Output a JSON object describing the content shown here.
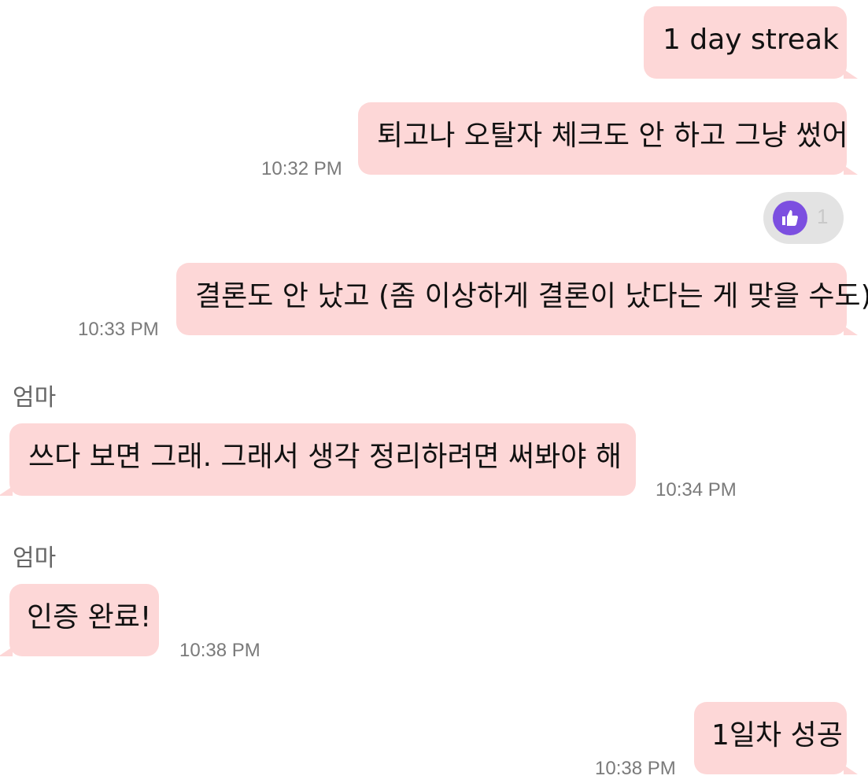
{
  "messages": [
    {
      "text": "1 day streak",
      "time": ""
    },
    {
      "text": "퇴고나 오탈자 체크도 안 하고 그냥 썼어",
      "time": "10:32 PM"
    },
    {
      "text": "결론도 안 났고 (좀 이상하게 결론이 났다는 게 맞을 수도)",
      "time": "10:33 PM"
    },
    {
      "sender": "엄마",
      "text": "쓰다 보면 그래. 그래서 생각 정리하려면 써봐야 해",
      "time": "10:34 PM"
    },
    {
      "sender": "엄마",
      "text": "인증 완료!",
      "time": "10:38 PM"
    },
    {
      "text": "1일차 성공",
      "time": "10:38 PM"
    }
  ],
  "reaction": {
    "icon": "thumbs-up-icon",
    "count": "1",
    "color": "#7c4fe0"
  },
  "colors": {
    "bubble": "#fdd7d7",
    "background": "#ffffff",
    "timestamp": "#7a7a7a"
  }
}
